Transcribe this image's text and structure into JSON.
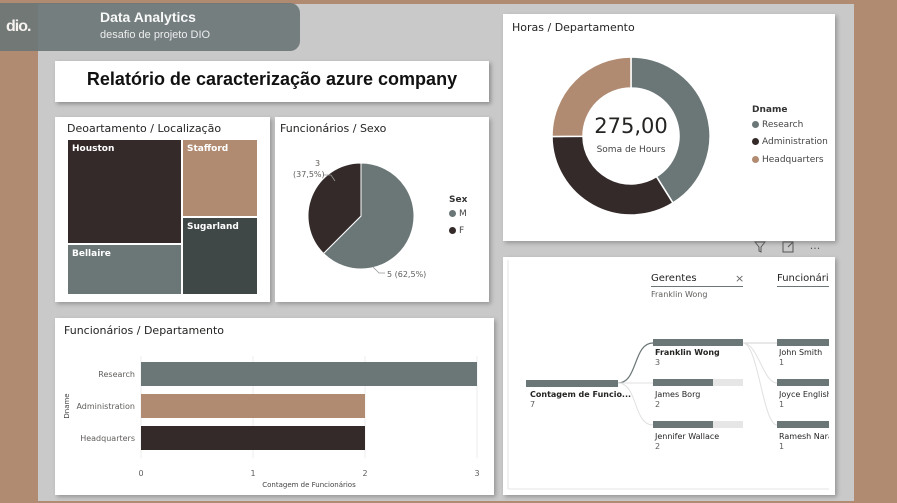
{
  "header": {
    "logo": "dio.",
    "title": "Data Analytics",
    "subtitle": "desafio de projeto DIO"
  },
  "report_title": "Relatório de caracterização azure company",
  "treemap": {
    "title": "Deoartamento / Localização",
    "items": [
      {
        "label": "Houston",
        "color": "#342a2a"
      },
      {
        "label": "Stafford",
        "color": "#b08b72"
      },
      {
        "label": "Sugarland",
        "color": "#3f4747"
      },
      {
        "label": "Bellaire",
        "color": "#6b7677"
      }
    ]
  },
  "pie": {
    "title": "Funcionários / Sexo",
    "legend_title": "Sex",
    "label_f_count": "3",
    "label_f_pct": "(37,5%)",
    "label_m": "5 (62,5%)"
  },
  "donut": {
    "title": "Horas / Departamento",
    "center_value": "275,00",
    "center_label": "Soma de Hours",
    "legend_title": "Dname"
  },
  "bar": {
    "title": "Funcionários / Departamento"
  },
  "decomp": {
    "col1_title": "Gerentes",
    "col1_filter": "Franklin Wong",
    "col2_title": "Funcionári",
    "root_label": "Contagem de Funcio...",
    "root_value": "7",
    "managers": [
      {
        "name": "Franklin Wong",
        "value": "3",
        "fill": 1.0
      },
      {
        "name": "James Borg",
        "value": "2",
        "fill": 0.67
      },
      {
        "name": "Jennifer Wallace",
        "value": "2",
        "fill": 0.67
      }
    ],
    "employees": [
      {
        "name": "John Smith",
        "value": "1"
      },
      {
        "name": "Joyce English",
        "value": "1"
      },
      {
        "name": "Ramesh Narayan",
        "value": "1"
      }
    ],
    "close_glyph": "×"
  },
  "toolbar": {
    "filter_icon": "filter-icon",
    "focus_icon": "focus-mode-icon",
    "more_icon": "more-options-icon",
    "more_glyph": "···"
  },
  "colors": {
    "gray": "#6b7677",
    "tan": "#b08b72",
    "dark": "#342a2a"
  },
  "chart_data": [
    {
      "type": "pie",
      "title": "Funcionários / Sexo",
      "legend_title": "Sex",
      "categories": [
        "M",
        "F"
      ],
      "values": [
        5,
        3
      ],
      "percent": [
        62.5,
        37.5
      ],
      "colors": [
        "#6b7677",
        "#342a2a"
      ]
    },
    {
      "type": "pie",
      "subtype": "donut",
      "title": "Horas / Departamento",
      "legend_title": "Dname",
      "categories": [
        "Research",
        "Administration",
        "Headquarters"
      ],
      "values": [
        113,
        93,
        69
      ],
      "total": 275,
      "colors": [
        "#6b7677",
        "#342a2a",
        "#b08b72"
      ]
    },
    {
      "type": "bar",
      "orientation": "horizontal",
      "title": "Funcionários / Departamento",
      "categories": [
        "Research",
        "Administration",
        "Headquarters"
      ],
      "values": [
        3,
        2,
        2
      ],
      "colors": [
        "#6b7677",
        "#b08b72",
        "#342a2a"
      ],
      "xlabel": "Contagem de Funcionários",
      "ylabel": "Dname",
      "xlim": [
        0,
        3
      ],
      "xticks": [
        "0",
        "1",
        "2",
        "3"
      ]
    }
  ]
}
